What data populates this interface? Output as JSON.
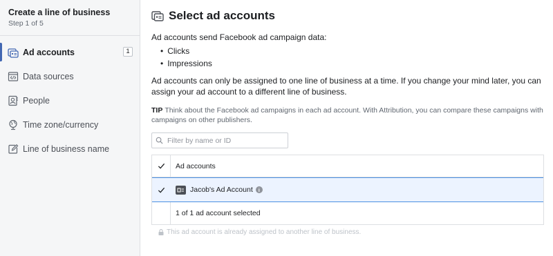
{
  "sidebar": {
    "title": "Create a line of business",
    "step": "Step 1 of 5",
    "items": [
      {
        "label": "Ad accounts",
        "icon": "ad-accounts-icon",
        "badge": "1",
        "active": true
      },
      {
        "label": "Data sources",
        "icon": "data-sources-icon"
      },
      {
        "label": "People",
        "icon": "people-icon"
      },
      {
        "label": "Time zone/currency",
        "icon": "globe-icon"
      },
      {
        "label": "Line of business name",
        "icon": "edit-icon"
      }
    ]
  },
  "main": {
    "title": "Select ad accounts",
    "intro": "Ad accounts send Facebook ad campaign data:",
    "bullets": [
      "Clicks",
      "Impressions"
    ],
    "paragraph": "Ad accounts can only be assigned to one line of business at a time. If you change your mind later, you can assign your ad account to a different line of business.",
    "tip_label": "TIP",
    "tip_text": "Think about the Facebook ad campaigns in each ad account. With Attribution, you can compare these campaigns with campaigns on other publishers.",
    "search": {
      "placeholder": "Filter by name or ID",
      "value": ""
    },
    "table": {
      "header": "Ad accounts",
      "rows": [
        {
          "name": "Jacob's Ad Account",
          "checked": true
        }
      ],
      "footer": "1 of 1 ad account selected"
    },
    "footnote": "This ad account is already assigned to another line of business."
  },
  "colors": {
    "accent": "#4267b2",
    "selected_row": "#ecf3ff",
    "selected_border": "#4a90e2"
  }
}
